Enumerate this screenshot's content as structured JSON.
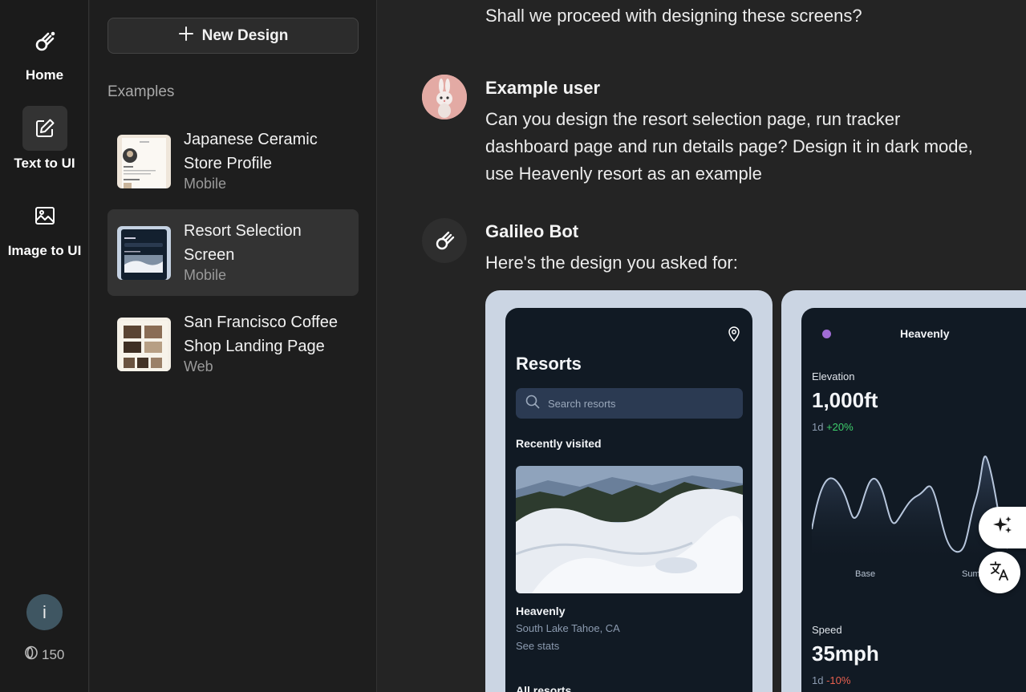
{
  "nav": {
    "home_label": "Home",
    "text_to_ui_label": "Text to UI",
    "image_to_ui_label": "Image to UI",
    "info_label": "i",
    "credits": "150"
  },
  "panel": {
    "new_design_label": "New Design",
    "examples_heading": "Examples",
    "examples": [
      {
        "title": "Japanese Ceramic Store Profile",
        "platform": "Mobile"
      },
      {
        "title": "Resort Selection Screen",
        "platform": "Mobile"
      },
      {
        "title": "San Francisco Coffee Shop Landing Page",
        "platform": "Web"
      }
    ]
  },
  "chat": {
    "prev_bot_tail": "Shall we proceed with designing these screens?",
    "user_name": "Example user",
    "user_message": "Can you design the resort selection page, run tracker dashboard page and run details page? Design it in dark mode, use Heavenly resort as an example",
    "bot_name": "Galileo Bot",
    "bot_message": "Here's the design you asked for:"
  },
  "design1": {
    "title": "Resorts",
    "search_placeholder": "Search resorts",
    "recent_heading": "Recently visited",
    "resort_name": "Heavenly",
    "resort_location": "South Lake Tahoe, CA",
    "see_stats": "See stats",
    "all_resorts": "All resorts"
  },
  "design2": {
    "title": "Heavenly",
    "elevation_label": "Elevation",
    "elevation_value": "1,000ft",
    "elevation_period": "1d",
    "elevation_change": "+20%",
    "axis_base": "Base",
    "axis_summit": "Sum",
    "speed_label": "Speed",
    "speed_value": "35mph",
    "speed_period": "1d",
    "speed_change": "-10%"
  },
  "colors": {
    "accent_green": "#3ecf6c",
    "accent_red": "#e8604f",
    "dot_purple": "#a06cd5",
    "frame_bg": "#cbd5e3",
    "phone_bg": "#111a24"
  }
}
